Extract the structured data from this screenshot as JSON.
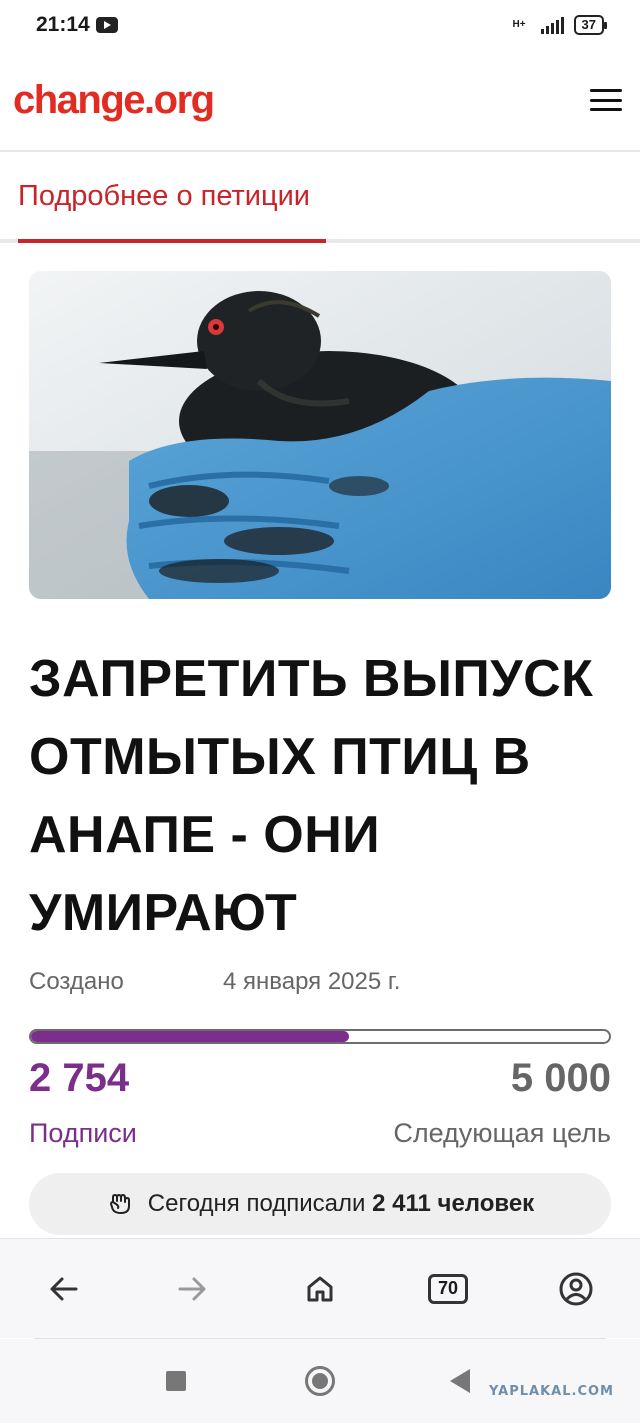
{
  "status_bar": {
    "time": "21:14",
    "network": "H+",
    "battery": "37",
    "icons": [
      "youtube-icon",
      "signal-icon",
      "battery-icon"
    ]
  },
  "header": {
    "logo": "change.org",
    "menu_icon": "hamburger-menu-icon"
  },
  "tab": {
    "label": "Подробнее о петиции"
  },
  "hero_image": {
    "description": "oil-covered-bird-in-blue-gloves"
  },
  "petition": {
    "title": "ЗАПРЕТИТЬ ВЫПУСК ОТМЫТЫХ ПТИЦ В АНАПЕ - ОНИ УМИРАЮТ",
    "created_label": "Создано",
    "created_date": "4 января 2025 г.",
    "signatures": "2 754",
    "signatures_label": "Подписи",
    "goal": "5 000",
    "goal_label": "Следующая цель",
    "progress_fraction": 0.5508,
    "today_prefix": "Сегодня подписали",
    "today_count": "2 411 человек"
  },
  "browser_bar": {
    "tab_count": "70",
    "icons": [
      "back-arrow-icon",
      "forward-arrow-icon",
      "home-icon",
      "tabs-icon",
      "profile-icon"
    ]
  },
  "system_nav": {
    "icons": [
      "recents-square-icon",
      "home-circle-icon",
      "back-triangle-icon"
    ]
  },
  "watermark": "YAPLAKAL.COM",
  "colors": {
    "brand_red": "#e22c22",
    "tab_red": "#c8242a",
    "purple": "#7b2e8c",
    "gray_text": "#666666"
  }
}
